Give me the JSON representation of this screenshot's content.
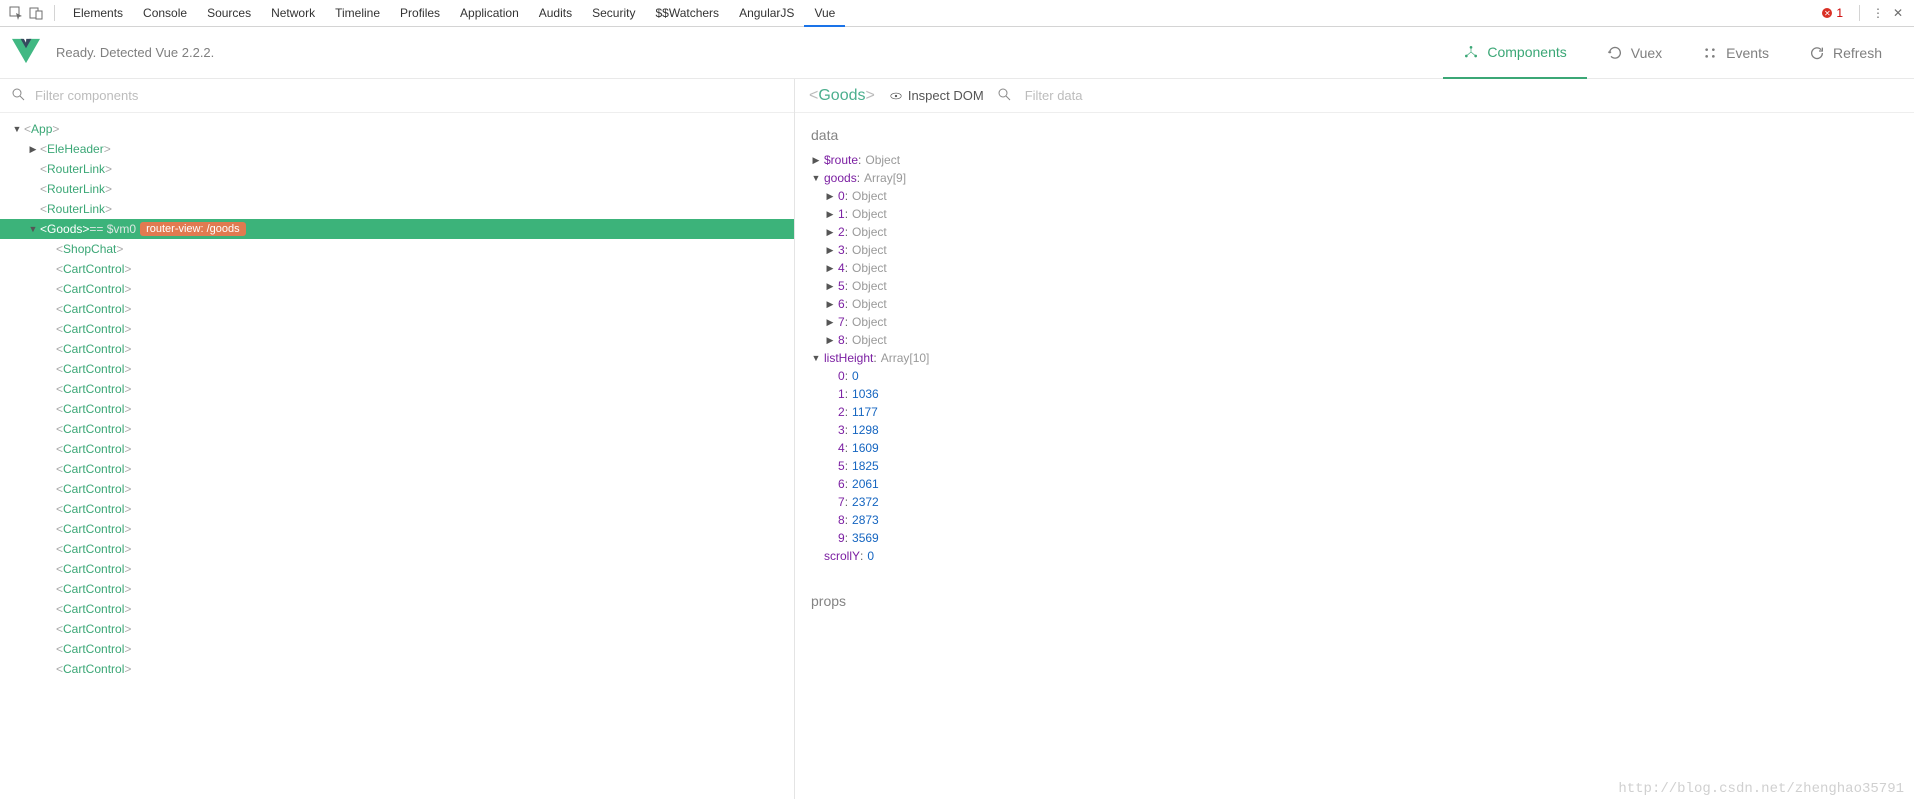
{
  "topbar": {
    "tabs": [
      "Elements",
      "Console",
      "Sources",
      "Network",
      "Timeline",
      "Profiles",
      "Application",
      "Audits",
      "Security",
      "$$Watchers",
      "AngularJS",
      "Vue"
    ],
    "active_tab": 11,
    "error_count": "1"
  },
  "vuerow": {
    "message": "Ready. Detected Vue 2.2.2.",
    "tabs": [
      {
        "label": "Components"
      },
      {
        "label": "Vuex"
      },
      {
        "label": "Events"
      },
      {
        "label": "Refresh"
      }
    ],
    "active": 0
  },
  "filter": {
    "placeholder": "Filter components"
  },
  "tree": [
    {
      "depth": 0,
      "arrow": "▼",
      "name": "App"
    },
    {
      "depth": 1,
      "arrow": "▶",
      "name": "EleHeader"
    },
    {
      "depth": 1,
      "arrow": "",
      "name": "RouterLink"
    },
    {
      "depth": 1,
      "arrow": "",
      "name": "RouterLink"
    },
    {
      "depth": 1,
      "arrow": "",
      "name": "RouterLink"
    },
    {
      "depth": 1,
      "arrow": "▼",
      "name": "Goods",
      "selected": true,
      "vm": " == $vm0",
      "badge": "router-view: /goods"
    },
    {
      "depth": 2,
      "arrow": "",
      "name": "ShopChat"
    },
    {
      "depth": 2,
      "arrow": "",
      "name": "CartControl"
    },
    {
      "depth": 2,
      "arrow": "",
      "name": "CartControl"
    },
    {
      "depth": 2,
      "arrow": "",
      "name": "CartControl"
    },
    {
      "depth": 2,
      "arrow": "",
      "name": "CartControl"
    },
    {
      "depth": 2,
      "arrow": "",
      "name": "CartControl"
    },
    {
      "depth": 2,
      "arrow": "",
      "name": "CartControl"
    },
    {
      "depth": 2,
      "arrow": "",
      "name": "CartControl"
    },
    {
      "depth": 2,
      "arrow": "",
      "name": "CartControl"
    },
    {
      "depth": 2,
      "arrow": "",
      "name": "CartControl"
    },
    {
      "depth": 2,
      "arrow": "",
      "name": "CartControl"
    },
    {
      "depth": 2,
      "arrow": "",
      "name": "CartControl"
    },
    {
      "depth": 2,
      "arrow": "",
      "name": "CartControl"
    },
    {
      "depth": 2,
      "arrow": "",
      "name": "CartControl"
    },
    {
      "depth": 2,
      "arrow": "",
      "name": "CartControl"
    },
    {
      "depth": 2,
      "arrow": "",
      "name": "CartControl"
    },
    {
      "depth": 2,
      "arrow": "",
      "name": "CartControl"
    },
    {
      "depth": 2,
      "arrow": "",
      "name": "CartControl"
    },
    {
      "depth": 2,
      "arrow": "",
      "name": "CartControl"
    },
    {
      "depth": 2,
      "arrow": "",
      "name": "CartControl"
    },
    {
      "depth": 2,
      "arrow": "",
      "name": "CartControl"
    },
    {
      "depth": 2,
      "arrow": "",
      "name": "CartControl"
    }
  ],
  "detail": {
    "title": "Goods",
    "inspect_label": "Inspect DOM",
    "filter_placeholder": "Filter data",
    "sections": {
      "data": "data",
      "props": "props"
    },
    "data_rows": [
      {
        "depth": 0,
        "arrow": "▶",
        "key": "$route",
        "val": "Object",
        "type": "obj"
      },
      {
        "depth": 0,
        "arrow": "▼",
        "key": "goods",
        "val": "Array[9]",
        "type": "obj"
      },
      {
        "depth": 1,
        "arrow": "▶",
        "key": "0",
        "val": "Object",
        "type": "obj"
      },
      {
        "depth": 1,
        "arrow": "▶",
        "key": "1",
        "val": "Object",
        "type": "obj"
      },
      {
        "depth": 1,
        "arrow": "▶",
        "key": "2",
        "val": "Object",
        "type": "obj"
      },
      {
        "depth": 1,
        "arrow": "▶",
        "key": "3",
        "val": "Object",
        "type": "obj"
      },
      {
        "depth": 1,
        "arrow": "▶",
        "key": "4",
        "val": "Object",
        "type": "obj"
      },
      {
        "depth": 1,
        "arrow": "▶",
        "key": "5",
        "val": "Object",
        "type": "obj"
      },
      {
        "depth": 1,
        "arrow": "▶",
        "key": "6",
        "val": "Object",
        "type": "obj"
      },
      {
        "depth": 1,
        "arrow": "▶",
        "key": "7",
        "val": "Object",
        "type": "obj"
      },
      {
        "depth": 1,
        "arrow": "▶",
        "key": "8",
        "val": "Object",
        "type": "obj"
      },
      {
        "depth": 0,
        "arrow": "▼",
        "key": "listHeight",
        "val": "Array[10]",
        "type": "obj"
      },
      {
        "depth": 1,
        "arrow": "",
        "key": "0",
        "val": "0",
        "type": "num"
      },
      {
        "depth": 1,
        "arrow": "",
        "key": "1",
        "val": "1036",
        "type": "num"
      },
      {
        "depth": 1,
        "arrow": "",
        "key": "2",
        "val": "1177",
        "type": "num"
      },
      {
        "depth": 1,
        "arrow": "",
        "key": "3",
        "val": "1298",
        "type": "num"
      },
      {
        "depth": 1,
        "arrow": "",
        "key": "4",
        "val": "1609",
        "type": "num"
      },
      {
        "depth": 1,
        "arrow": "",
        "key": "5",
        "val": "1825",
        "type": "num"
      },
      {
        "depth": 1,
        "arrow": "",
        "key": "6",
        "val": "2061",
        "type": "num"
      },
      {
        "depth": 1,
        "arrow": "",
        "key": "7",
        "val": "2372",
        "type": "num"
      },
      {
        "depth": 1,
        "arrow": "",
        "key": "8",
        "val": "2873",
        "type": "num"
      },
      {
        "depth": 1,
        "arrow": "",
        "key": "9",
        "val": "3569",
        "type": "num"
      },
      {
        "depth": 0,
        "arrow": "",
        "key": "scrollY",
        "val": "0",
        "type": "num"
      }
    ]
  },
  "watermark": "http://blog.csdn.net/zhenghao35791"
}
